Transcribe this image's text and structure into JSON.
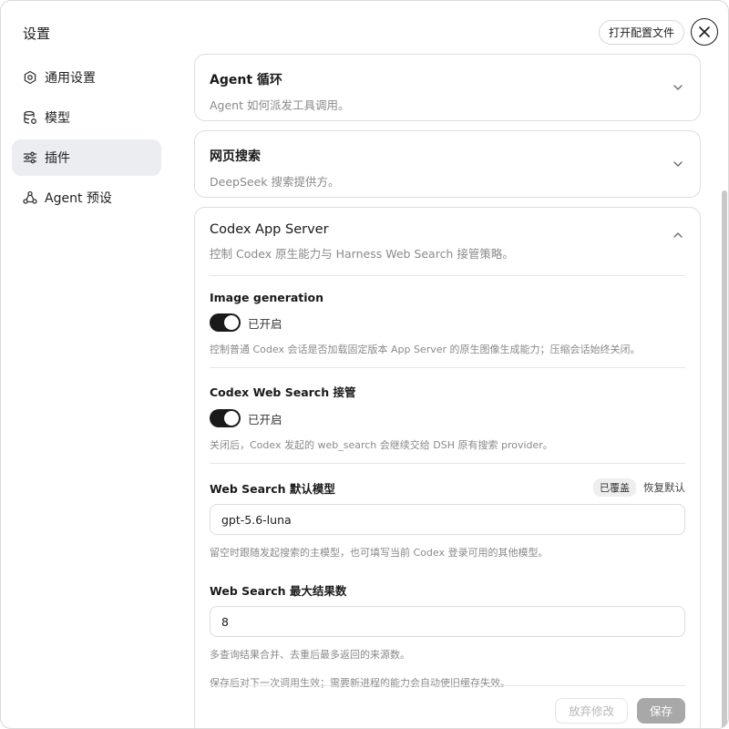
{
  "header": {
    "title": "设置",
    "open_config_label": "打开配置文件"
  },
  "sidebar": {
    "items": [
      {
        "label": "通用设置",
        "icon": "gear-icon",
        "active": false
      },
      {
        "label": "模型",
        "icon": "database-icon",
        "active": false
      },
      {
        "label": "插件",
        "icon": "sliders-icon",
        "active": true
      },
      {
        "label": "Agent 预设",
        "icon": "agent-icon",
        "active": false
      }
    ]
  },
  "cards": {
    "agent_loop": {
      "title": "Agent 循环",
      "subtitle": "Agent 如何派发工具调用。"
    },
    "web_search": {
      "title": "网页搜索",
      "subtitle": "DeepSeek 搜索提供方。"
    },
    "codex": {
      "title": "Codex App Server",
      "subtitle": "控制 Codex 原生能力与 Harness Web Search 接管策略。",
      "image_generation": {
        "label": "Image generation",
        "state": "已开启",
        "enabled": true,
        "help": "控制普通 Codex 会话是否加载固定版本 App Server 的原生图像生成能力；压缩会话始终关闭。"
      },
      "web_search_takeover": {
        "label": "Codex Web Search 接管",
        "state": "已开启",
        "enabled": true,
        "help": "关闭后，Codex 发起的 web_search 会继续交给 DSH 原有搜索 provider。"
      },
      "default_model": {
        "label": "Web Search 默认模型",
        "badge": "已覆盖",
        "reset": "恢复默认",
        "value": "gpt-5.6-luna",
        "help": "留空时跟随发起搜索的主模型，也可填写当前 Codex 登录可用的其他模型。"
      },
      "max_results": {
        "label": "Web Search 最大结果数",
        "value": "8",
        "help": "多查询结果合并、去重后最多返回的来源数。"
      },
      "note": "保存后对下一次调用生效；需要新进程的能力会自动使旧缓存失效。",
      "discard_label": "放弃修改",
      "save_label": "保存"
    }
  },
  "colors": {
    "accent": "#1a1a1a",
    "sidebar_active_bg": "#ebedf1",
    "muted_text": "#8a8a8a",
    "save_disabled": "#a8a8a8"
  }
}
